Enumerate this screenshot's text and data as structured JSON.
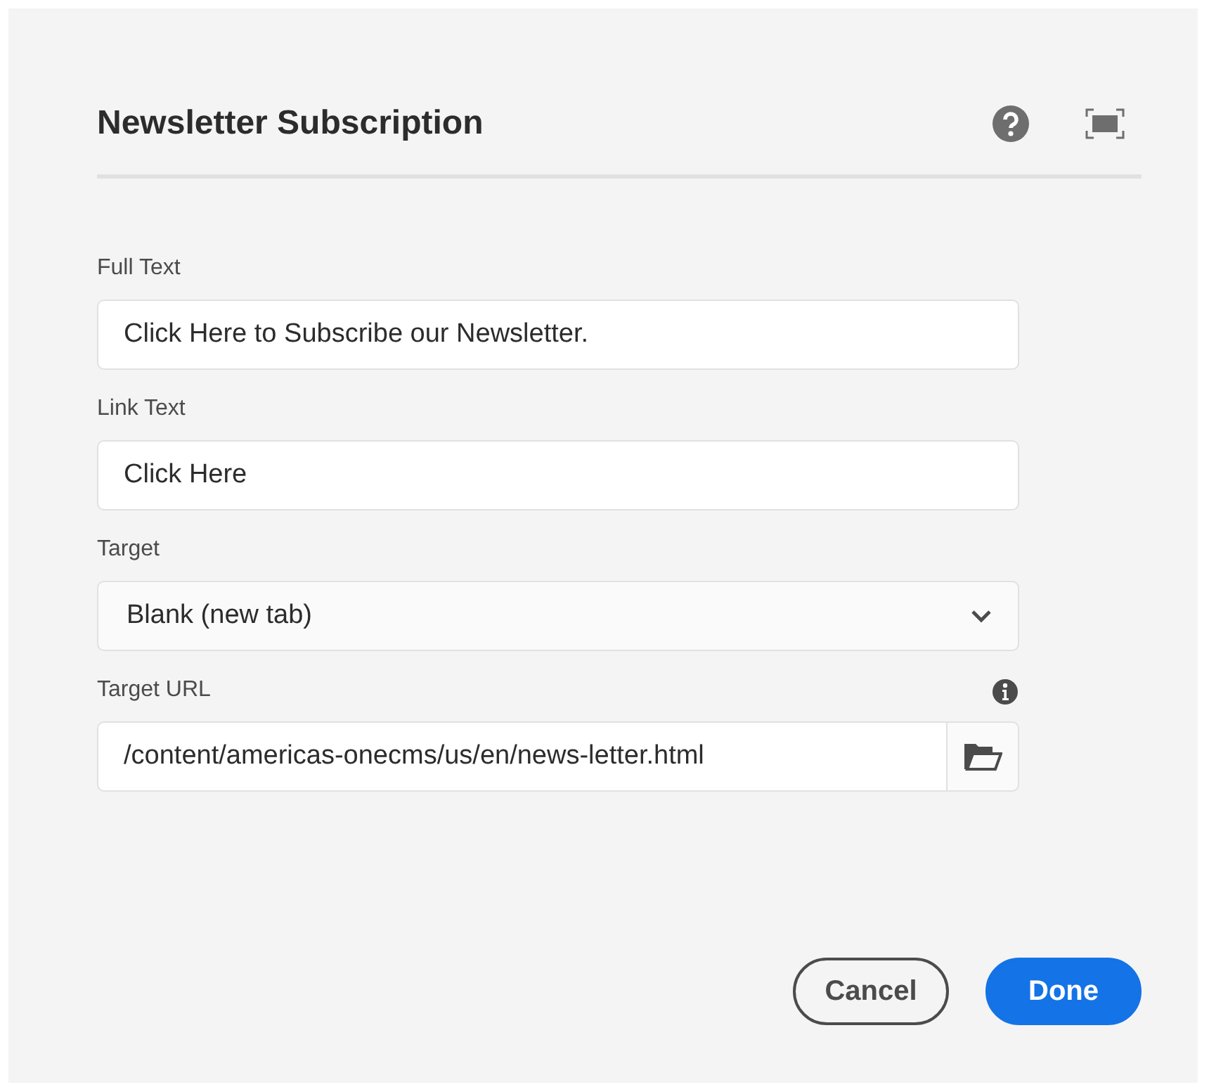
{
  "dialog": {
    "title": "Newsletter Subscription"
  },
  "fields": [
    {
      "kind": "text",
      "label": "Full Text",
      "value": "Click Here to Subscribe our Newsletter."
    },
    {
      "kind": "text",
      "label": "Link Text",
      "value": "Click Here"
    },
    {
      "kind": "select",
      "label": "Target",
      "value": "Blank (new tab)"
    },
    {
      "kind": "path",
      "label": "Target URL",
      "value": "/content/americas-onecms/us/en/news-letter.html",
      "info": true
    }
  ],
  "buttons": [
    {
      "kind": "secondary",
      "label": "Cancel"
    },
    {
      "kind": "primary",
      "label": "Done"
    }
  ]
}
